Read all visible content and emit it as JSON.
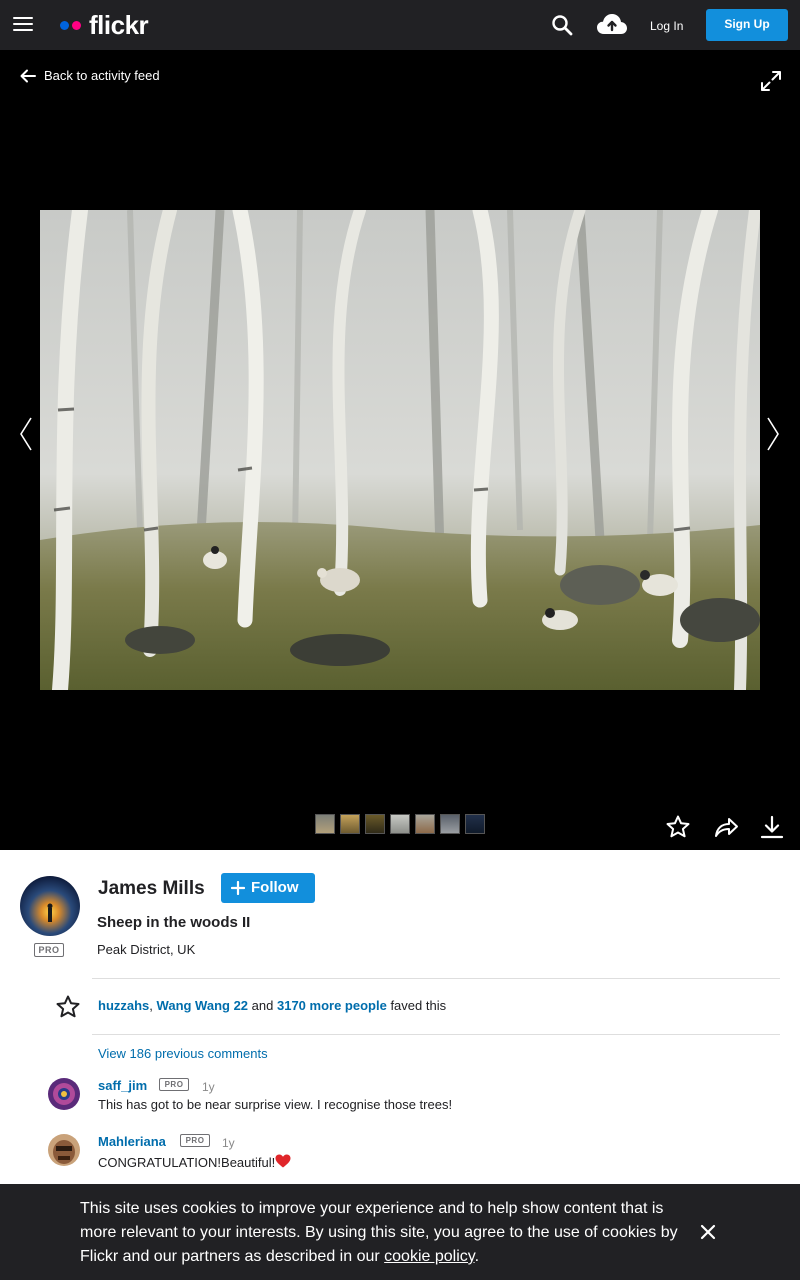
{
  "nav": {
    "logo_text": "flickr",
    "login_label": "Log In",
    "signup_label": "Sign Up",
    "brand_blue": "#0063dc",
    "brand_pink": "#ff0084",
    "icons": [
      "menu-icon",
      "search-icon",
      "upload-cloud-icon"
    ]
  },
  "viewer": {
    "back_label": "Back to activity feed",
    "icons": [
      "arrow-left-icon",
      "fullscreen-icon",
      "chevron-left-icon",
      "chevron-right-icon",
      "star-outline-icon",
      "share-icon",
      "download-icon"
    ],
    "photostream_thumbnail_count": 7
  },
  "photo": {
    "author": "James Mills",
    "follow_label": "Follow",
    "title": "Sheep in the woods II",
    "location": "Peak District, UK",
    "pro_label": "PRO"
  },
  "faves": {
    "user1": "huzzahs",
    "separator": ",",
    "user2": "Wang Wang 22",
    "and_text": "and",
    "more_people": "3170 more people",
    "suffix": "faved this"
  },
  "comments": {
    "view_previous": "View 186 previous comments",
    "items": [
      {
        "user": "saff_jim",
        "pro": "PRO",
        "time": "1y",
        "text": "This has got to be near surprise view. I recognise those trees!"
      },
      {
        "user": "Mahleriana",
        "pro": "PRO",
        "time": "1y",
        "text": "CONGRATULATION!Beautiful!"
      }
    ]
  },
  "cookie": {
    "text": "This site uses cookies to improve your experience and to help show content that is more relevant to your interests. By using this site, you agree to the use of cookies by Flickr and our partners as described in our",
    "link": "cookie policy",
    "end": "."
  },
  "colors": {
    "nav_bg": "#212124",
    "accent_button": "#128fdc",
    "link": "#006dac",
    "heart": "#e0262a"
  }
}
